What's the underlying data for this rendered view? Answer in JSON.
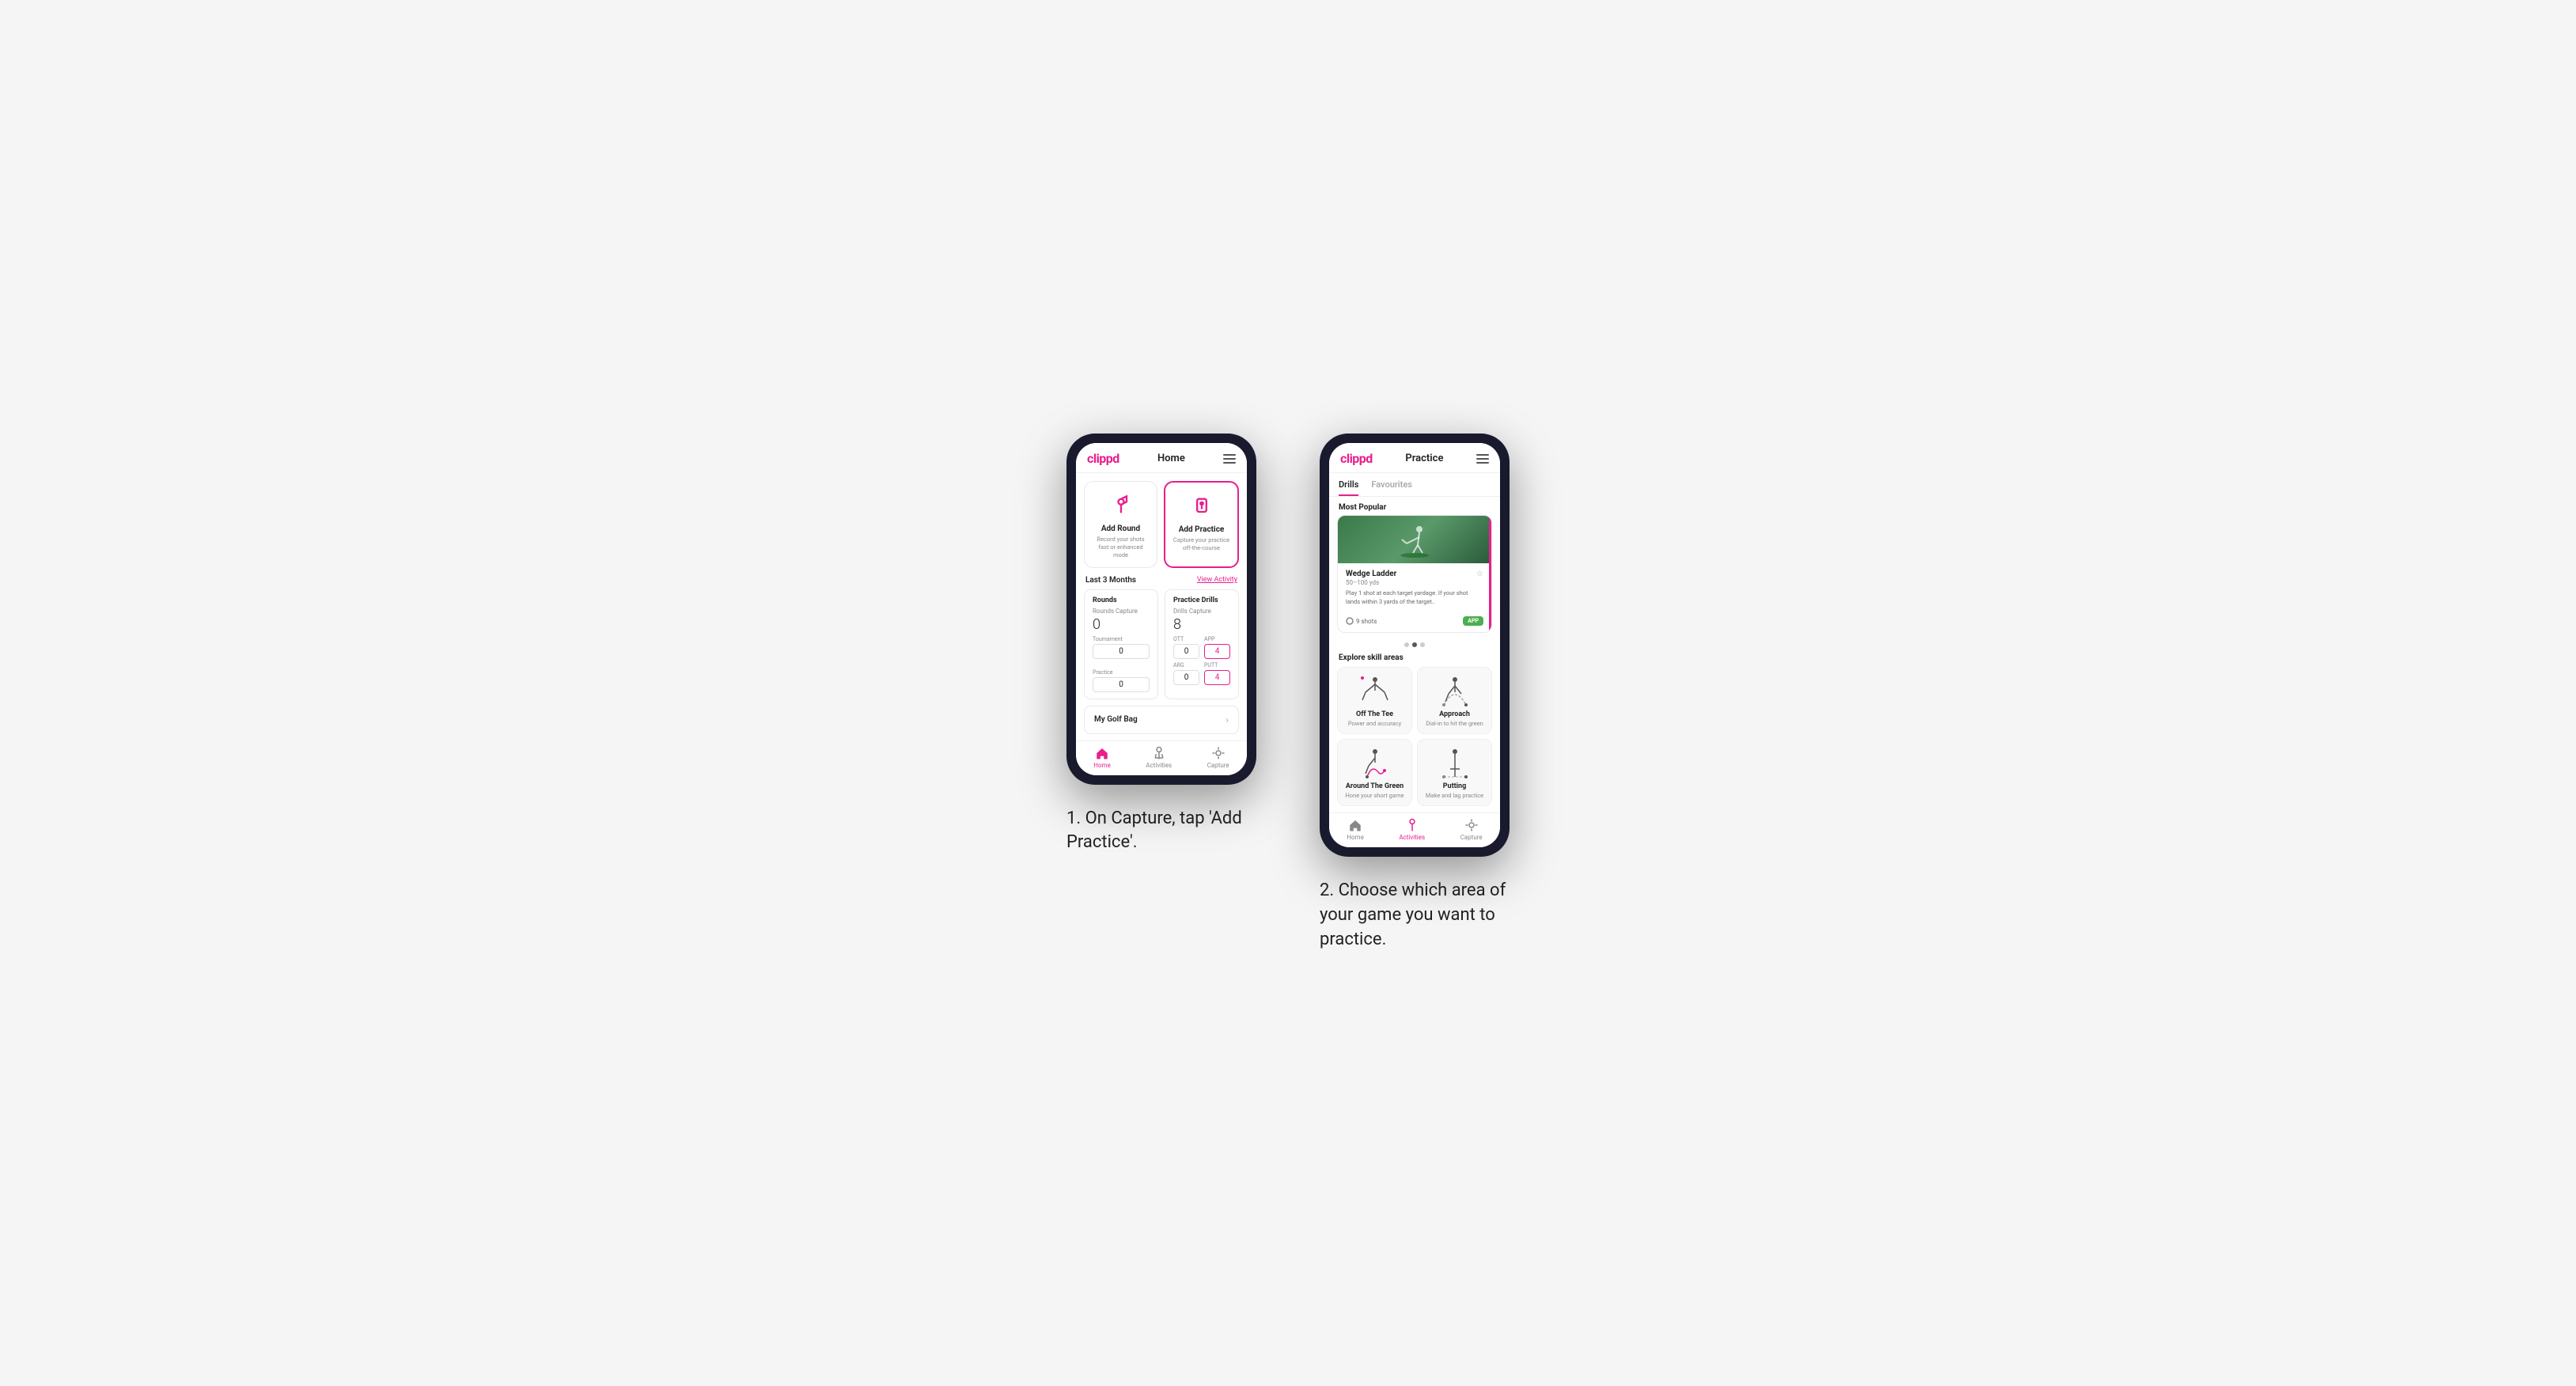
{
  "screenshots": {
    "screen1": {
      "header": {
        "logo": "clippd",
        "title": "Home"
      },
      "action_cards": [
        {
          "id": "add-round",
          "title": "Add Round",
          "subtitle": "Record your shots fast or enhanced mode",
          "icon_type": "flag"
        },
        {
          "id": "add-practice",
          "title": "Add Practice",
          "subtitle": "Capture your practice off-the-course",
          "icon_type": "practice",
          "highlighted": true
        }
      ],
      "section": {
        "title": "Last 3 Months",
        "link": "View Activity"
      },
      "rounds": {
        "title": "Rounds",
        "rounds_capture_label": "Rounds Capture",
        "rounds_value": "0",
        "sub_labels": [
          "Tournament",
          "OTT",
          "APP"
        ],
        "tournament_value": "0",
        "ott_value": "0",
        "app_value": "4",
        "practice_label": "Practice",
        "practice_value": "0",
        "arg_label": "ARG",
        "arg_value": "0",
        "putt_label": "PUTT",
        "putt_value": "4"
      },
      "practice_drills": {
        "title": "Practice Drills",
        "drills_capture_label": "Drills Capture",
        "drills_value": "8"
      },
      "golf_bag": {
        "label": "My Golf Bag"
      },
      "bottom_nav": [
        {
          "label": "Home",
          "active": true,
          "icon": "home"
        },
        {
          "label": "Activities",
          "active": false,
          "icon": "activities"
        },
        {
          "label": "Capture",
          "active": false,
          "icon": "capture"
        }
      ]
    },
    "screen2": {
      "header": {
        "logo": "clippd",
        "title": "Practice"
      },
      "tabs": [
        {
          "label": "Drills",
          "active": true
        },
        {
          "label": "Favourites",
          "active": false
        }
      ],
      "most_popular_label": "Most Popular",
      "featured": {
        "title": "Wedge Ladder",
        "yardage": "50–100 yds",
        "description": "Play 1 shot at each target yardage. If your shot lands within 3 yards of the target..",
        "shots": "9 shots",
        "badge": "APP"
      },
      "dots": [
        {
          "active": false
        },
        {
          "active": true
        },
        {
          "active": false
        }
      ],
      "explore_label": "Explore skill areas",
      "skill_areas": [
        {
          "id": "off-the-tee",
          "title": "Off The Tee",
          "subtitle": "Power and accuracy"
        },
        {
          "id": "approach",
          "title": "Approach",
          "subtitle": "Dial-in to hit the green"
        },
        {
          "id": "around-the-green",
          "title": "Around The Green",
          "subtitle": "Hone your short game"
        },
        {
          "id": "putting",
          "title": "Putting",
          "subtitle": "Make and lag practice"
        }
      ],
      "bottom_nav": [
        {
          "label": "Home",
          "active": false,
          "icon": "home"
        },
        {
          "label": "Activities",
          "active": true,
          "icon": "activities"
        },
        {
          "label": "Capture",
          "active": false,
          "icon": "capture"
        }
      ]
    }
  },
  "captions": {
    "caption1": "1. On Capture, tap 'Add Practice'.",
    "caption2": "2. Choose which area of your game you want to practice."
  }
}
